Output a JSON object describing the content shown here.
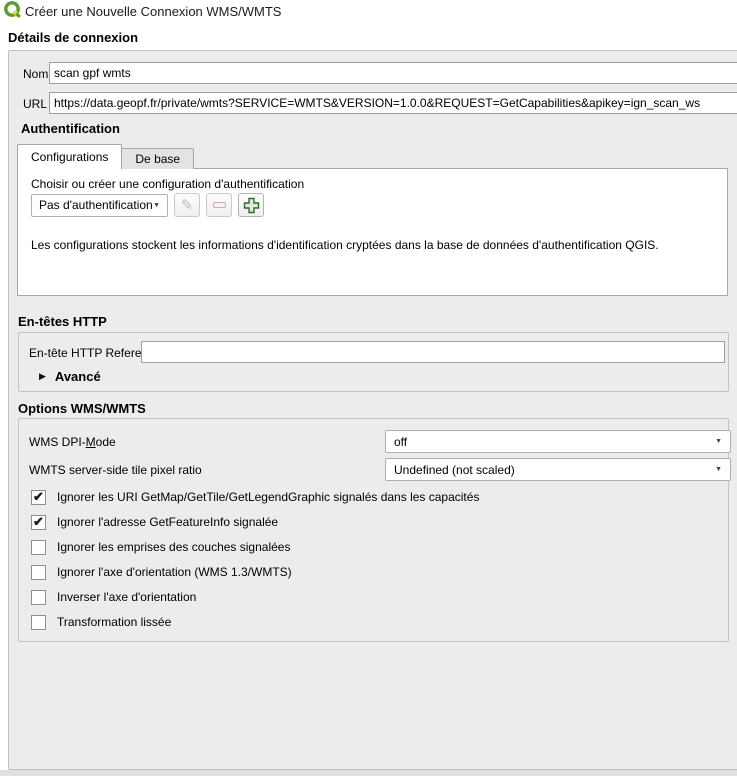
{
  "window": {
    "title": "Créer une Nouvelle Connexion WMS/WMTS",
    "icon": "qgis-logo-icon"
  },
  "details": {
    "title": "Détails de connexion",
    "nom_label": "Nom",
    "nom_value": "scan gpf wmts",
    "url_label": "URL",
    "url_value": "https://data.geopf.fr/private/wmts?SERVICE=WMTS&VERSION=1.0.0&REQUEST=GetCapabilities&apikey=ign_scan_ws"
  },
  "auth": {
    "title": "Authentification",
    "tabs": [
      {
        "label": "Configurations",
        "active": true
      },
      {
        "label": "De base",
        "active": false
      }
    ],
    "choose_label": "Choisir ou créer une configuration d'authentification",
    "selected_config": "Pas d'authentification",
    "edit_icon": "pencil-icon",
    "remove_icon": "minus-icon",
    "add_icon": "plus-icon",
    "info_text": "Les configurations stockent les informations d'identification cryptées dans la base de données d'authentification QGIS."
  },
  "http_headers": {
    "title": "En-têtes HTTP",
    "referer_label": "En-tête HTTP Referer",
    "referer_value": "",
    "advanced_label": "Avancé"
  },
  "wms_options": {
    "title": "Options WMS/WMTS",
    "dpi_mode": {
      "label_pre": "WMS DPI-",
      "label_mnemonic": "M",
      "label_post": "ode",
      "value": "off"
    },
    "tile_ratio": {
      "label": "WMTS server-side tile pixel ratio",
      "value": "Undefined (not scaled)"
    },
    "checkboxes": [
      {
        "label": "Ignorer les URI GetMap/GetTile/GetLegendGraphic signalés dans les capacités",
        "checked": true
      },
      {
        "label": "Ignorer l'adresse GetFeatureInfo signalée",
        "checked": true
      },
      {
        "label": "Ignorer les emprises des couches signalées",
        "checked": false
      },
      {
        "label": "Ignorer l'axe d'orientation (WMS 1.3/WMTS)",
        "checked": false
      },
      {
        "label": "Inverser l'axe d'orientation",
        "checked": false
      },
      {
        "label": "Transformation lissée",
        "checked": false
      }
    ]
  },
  "icons": {
    "dropdown_arrow_glyph": "▼",
    "advanced_arrow_glyph": "▶",
    "checkmark_glyph": "✔",
    "pencil_glyph": "✎"
  },
  "colors": {
    "logo_green": "#5a9e2f",
    "logo_yellow": "#eed94b",
    "add_plus_green": "#2e6b2e",
    "groupbox_bg": "#ececec"
  }
}
